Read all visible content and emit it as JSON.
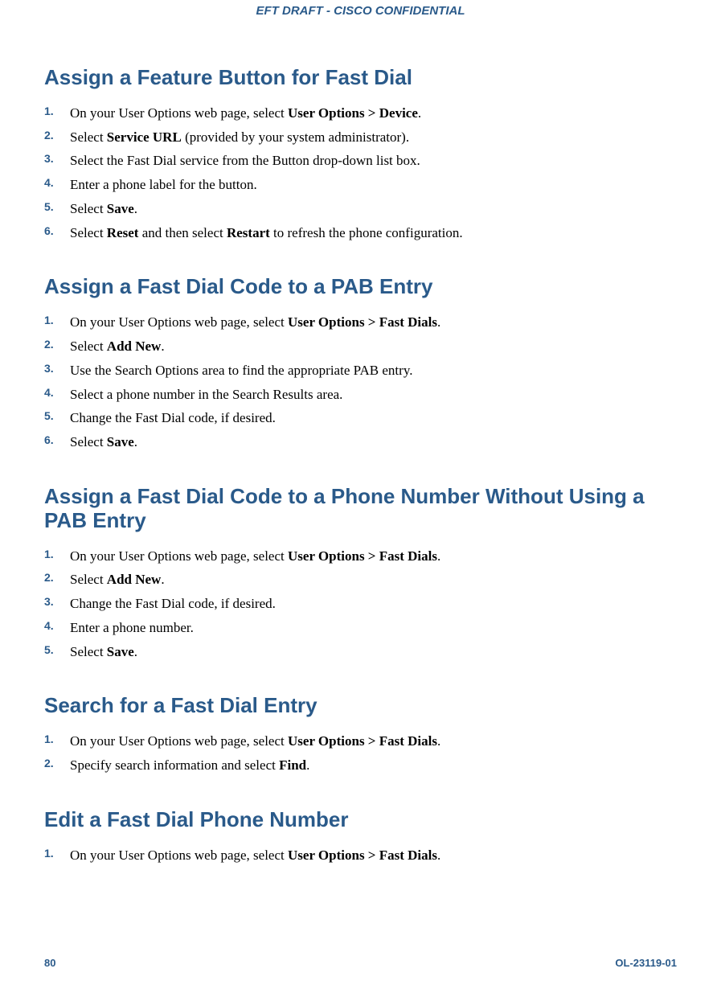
{
  "header": "EFT DRAFT - CISCO CONFIDENTIAL",
  "sections": [
    {
      "title": "Assign a Feature Button for Fast Dial",
      "steps": [
        [
          {
            "t": "On your User Options web page, select "
          },
          {
            "t": "User Options > Device",
            "b": true
          },
          {
            "t": "."
          }
        ],
        [
          {
            "t": "Select "
          },
          {
            "t": "Service URL",
            "b": true
          },
          {
            "t": " (provided by your system administrator)."
          }
        ],
        [
          {
            "t": "Select the Fast Dial service from the Button drop-down list box."
          }
        ],
        [
          {
            "t": "Enter a phone label for the button."
          }
        ],
        [
          {
            "t": "Select "
          },
          {
            "t": "Save",
            "b": true
          },
          {
            "t": "."
          }
        ],
        [
          {
            "t": "Select "
          },
          {
            "t": "Reset",
            "b": true
          },
          {
            "t": " and then select "
          },
          {
            "t": "Restart",
            "b": true
          },
          {
            "t": " to refresh the phone configuration."
          }
        ]
      ]
    },
    {
      "title": "Assign a Fast Dial Code to a PAB Entry",
      "steps": [
        [
          {
            "t": "On your User Options web page, select "
          },
          {
            "t": "User Options > Fast Dials",
            "b": true
          },
          {
            "t": "."
          }
        ],
        [
          {
            "t": "Select "
          },
          {
            "t": "Add New",
            "b": true
          },
          {
            "t": "."
          }
        ],
        [
          {
            "t": "Use the Search Options area to find the appropriate PAB entry."
          }
        ],
        [
          {
            "t": "Select a phone number in the Search Results area."
          }
        ],
        [
          {
            "t": "Change the Fast Dial code, if desired."
          }
        ],
        [
          {
            "t": "Select "
          },
          {
            "t": "Save",
            "b": true
          },
          {
            "t": "."
          }
        ]
      ]
    },
    {
      "title": "Assign a Fast Dial Code to a Phone Number Without Using a PAB Entry",
      "steps": [
        [
          {
            "t": "On your User Options web page, select "
          },
          {
            "t": "User Options > Fast Dials",
            "b": true
          },
          {
            "t": "."
          }
        ],
        [
          {
            "t": "Select "
          },
          {
            "t": "Add New",
            "b": true
          },
          {
            "t": "."
          }
        ],
        [
          {
            "t": "Change the Fast Dial code, if desired."
          }
        ],
        [
          {
            "t": "Enter a phone number."
          }
        ],
        [
          {
            "t": "Select "
          },
          {
            "t": "Save",
            "b": true
          },
          {
            "t": "."
          }
        ]
      ]
    },
    {
      "title": "Search for a Fast Dial Entry",
      "steps": [
        [
          {
            "t": "On your User Options web page, select "
          },
          {
            "t": "User Options > Fast Dials",
            "b": true
          },
          {
            "t": "."
          }
        ],
        [
          {
            "t": "Specify search information and select "
          },
          {
            "t": "Find",
            "b": true
          },
          {
            "t": "."
          }
        ]
      ]
    },
    {
      "title": "Edit a Fast Dial Phone Number",
      "steps": [
        [
          {
            "t": "On your User Options web page, select "
          },
          {
            "t": "User Options > Fast Dials",
            "b": true
          },
          {
            "t": "."
          }
        ]
      ]
    }
  ],
  "footer": {
    "page": "80",
    "docid": "OL-23119-01"
  }
}
